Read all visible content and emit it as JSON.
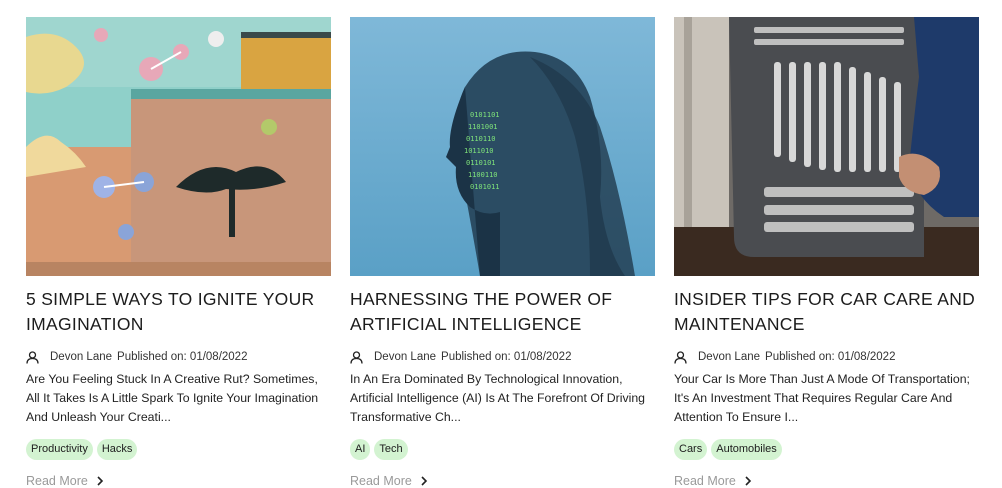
{
  "cards": [
    {
      "title": "5 SIMPLE WAYS TO IGNITE YOUR IMAGINATION",
      "author": "Devon Lane",
      "published": "Published on: 01/08/2022",
      "excerpt": "Are You Feeling Stuck In A Creative Rut? Sometimes, All It Takes Is A Little Spark To Ignite Your Imagination And Unleash Your Creati...",
      "tags": [
        "Productivity",
        "Hacks"
      ],
      "read_more": "Read More"
    },
    {
      "title": "HARNESSING THE POWER OF ARTIFICIAL INTELLIGENCE",
      "author": "Devon Lane",
      "published": "Published on: 01/08/2022",
      "excerpt": "In An Era Dominated By Technological Innovation, Artificial Intelligence (AI) Is At The Forefront Of Driving Transformative Ch...",
      "tags": [
        "AI",
        "Tech"
      ],
      "read_more": "Read More"
    },
    {
      "title": "INSIDER TIPS FOR CAR CARE AND MAINTENANCE",
      "author": "Devon Lane",
      "published": "Published on: 01/08/2022",
      "excerpt": "Your Car Is More Than Just A Mode Of Transportation; It's An Investment That Requires Regular Care And Attention To Ensure I...",
      "tags": [
        "Cars",
        "Automobiles"
      ],
      "read_more": "Read More"
    }
  ],
  "colors": {
    "tag_bg": "#d3f3d1",
    "read_more": "#9a9a9a"
  },
  "icons": {
    "author": "user-icon",
    "read_more": "chevron-right-icon"
  }
}
